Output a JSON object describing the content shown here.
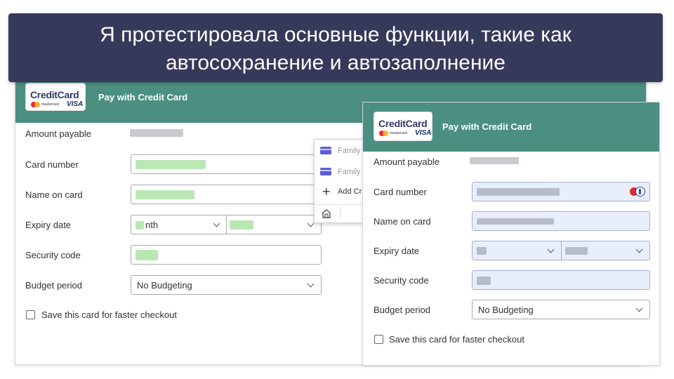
{
  "banner": {
    "line1": "Я протестировала основные функции, такие как",
    "line2": "автосохранение и автозаполнение"
  },
  "colors": {
    "banner_bg": "#353a5a",
    "header_bg": "#4b8f81",
    "autofill_bg": "#e8eefc"
  },
  "left_form": {
    "logo_text_credit": "Credit",
    "logo_text_card": "Card",
    "logo_mastercard": "mastercard",
    "logo_visa": "VISA",
    "header_title": "Pay with Credit Card",
    "amount_label": "Amount payable",
    "card_number_label": "Card number",
    "name_label": "Name on card",
    "expiry_label": "Expiry date",
    "expiry_month_visible": "nth",
    "security_label": "Security code",
    "budget_label": "Budget period",
    "budget_value": "No Budgeting",
    "save_card_label": "Save this card for faster checkout"
  },
  "autofill_dropdown": {
    "items": [
      {
        "label": "Family",
        "icon": "credit-card-icon"
      },
      {
        "label": "Family",
        "icon": "credit-card-icon"
      }
    ],
    "add_label": "Add Cr",
    "footer_icon": "home-icon"
  },
  "right_form": {
    "logo_text_credit": "Credit",
    "logo_text_card": "Card",
    "logo_mastercard": "mastercard",
    "logo_visa": "VISA",
    "header_title": "Pay with Credit Card",
    "amount_label": "Amount payable",
    "card_number_label": "Card number",
    "name_label": "Name on card",
    "expiry_label": "Expiry date",
    "security_label": "Security code",
    "budget_label": "Budget period",
    "budget_value": "No Budgeting",
    "save_card_label": "Save this card for faster checkout",
    "password_manager_icon": "password-manager-icon"
  }
}
